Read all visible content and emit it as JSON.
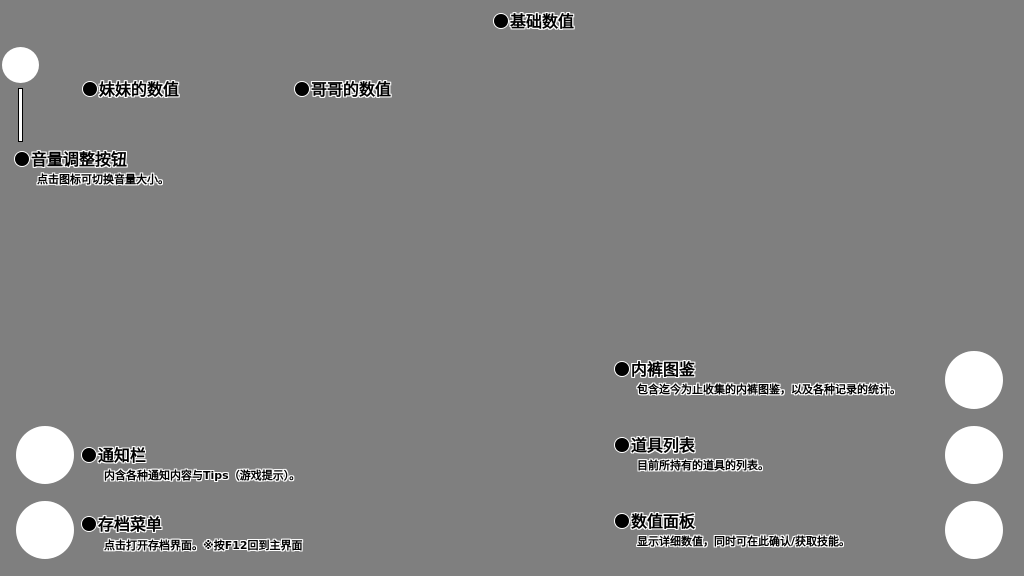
{
  "labels": {
    "base_stats": "基础数值",
    "sister_stats": "妹妹的数值",
    "brother_stats": "哥哥的数值",
    "volume_button": "音量调整按钮",
    "volume_desc": "点击图标可切换音量大小。",
    "panty_gallery": "内裤图鉴",
    "panty_gallery_desc": "包含迄今为止收集的内裤图鉴，以及各种记录的统计。",
    "notification_bar": "通知栏",
    "notification_desc": "内含各种通知内容与Tips（游戏提示）。",
    "item_list": "道具列表",
    "item_list_desc": "目前所持有的道具的列表。",
    "save_menu": "存档菜单",
    "save_menu_desc": "点击打开存档界面。※按F12回到主界面",
    "stats_panel": "数值面板",
    "stats_panel_desc": "显示详细数值，同时可在此确认/获取技能。"
  },
  "icons": {
    "volume": "volume-icon",
    "notification": "notification-icon",
    "save": "save-icon",
    "gallery": "gallery-icon",
    "items": "items-icon",
    "stats": "stats-icon"
  },
  "colors": {
    "background": "#7f7f7f",
    "placeholder": "#ffffff"
  }
}
